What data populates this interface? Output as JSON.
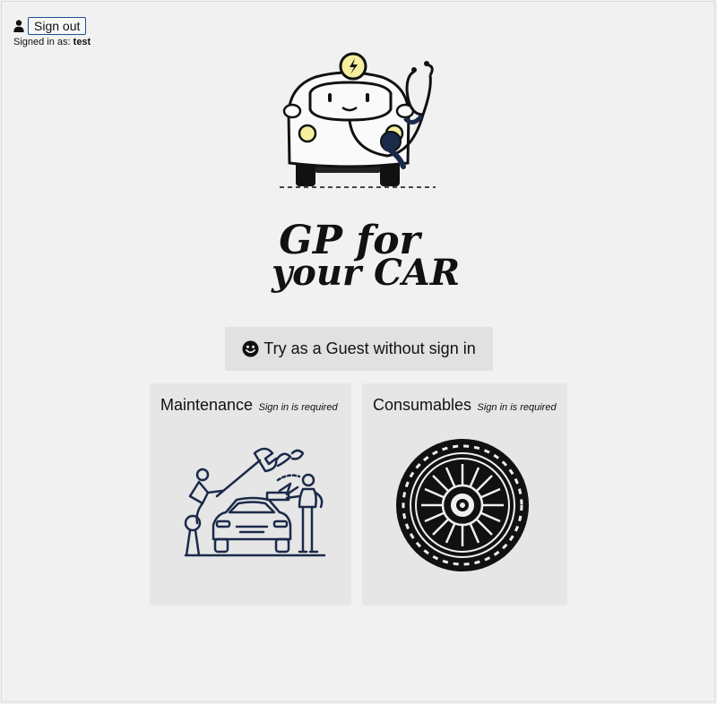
{
  "account": {
    "user_icon": "user-icon",
    "sign_out_label": "Sign out",
    "signed_in_prefix": "Signed in as: ",
    "username": "test"
  },
  "logo": {
    "line1": "GP for",
    "line2": "your CAR",
    "icon": "car-with-stethoscope-logo"
  },
  "guest": {
    "label": "Try as a Guest without sign in",
    "icon": "smile-icon"
  },
  "cards": {
    "maintenance": {
      "title": "Maintenance",
      "note": "Sign in is required",
      "icon": "maintenance-illustration"
    },
    "consumables": {
      "title": "Consumables",
      "note": "Sign in is required",
      "icon": "tire-illustration"
    }
  },
  "colors": {
    "navy": "#1b2a4a",
    "yellow": "#f5ee9e",
    "background": "#f1f1f1",
    "card": "#e6e6e6",
    "button_border": "#1d4f91"
  }
}
